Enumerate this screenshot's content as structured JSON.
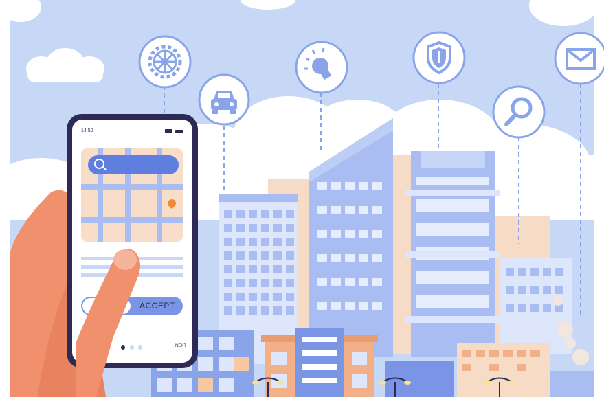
{
  "phone": {
    "status_time": "14:50",
    "accept_label": "ACCEPT",
    "next_label": "NEXT"
  },
  "icons": [
    "gear-icon",
    "car-icon",
    "lightbulb-icon",
    "shield-icon",
    "search-icon",
    "envelope-icon"
  ],
  "colors": {
    "sky": "#c7d8f6",
    "cloud": "#ffffff",
    "icon_blue": "#8aa4ea",
    "building_blue": "#a9bdf2",
    "building_peach": "#f6dcc6",
    "accent_orange": "#f28a3c",
    "phone_frame": "#2d2b55",
    "hand": "#f0906c"
  }
}
